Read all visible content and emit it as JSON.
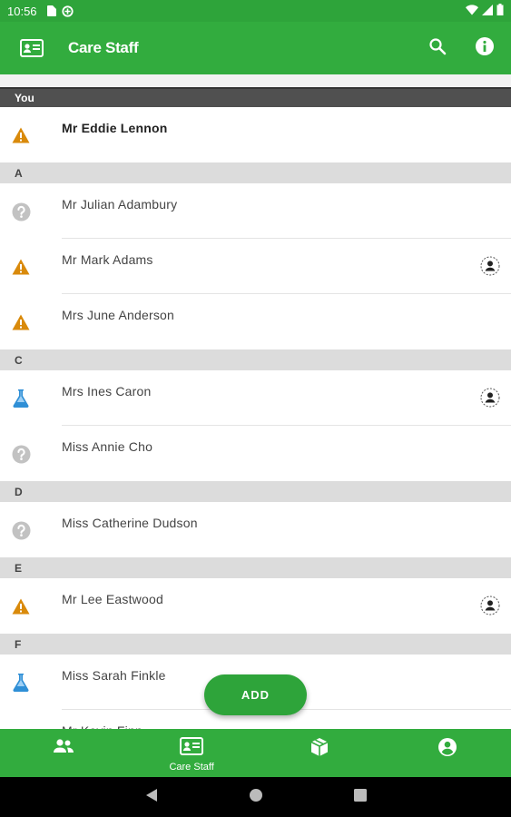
{
  "status_bar": {
    "time": "10:56",
    "left_icons": [
      "sim-card-icon",
      "data-saver-icon"
    ],
    "right_icons": [
      "wifi-icon",
      "cell-signal-icon",
      "battery-icon"
    ]
  },
  "app_bar": {
    "title": "Care Staff",
    "icons": [
      "id-card-icon",
      "search-icon",
      "info-icon"
    ]
  },
  "you_section": {
    "header": "You",
    "row": {
      "name": "Mr Eddie Lennon",
      "status_icon": "warning-icon",
      "has_person_icon": false
    }
  },
  "sections": [
    {
      "letter": "A",
      "rows": [
        {
          "name": "Mr Julian Adambury",
          "status_icon": "help-icon",
          "has_person_icon": false
        },
        {
          "name": "Mr Mark Adams",
          "status_icon": "warning-icon",
          "has_person_icon": true
        },
        {
          "name": "Mrs June Anderson",
          "status_icon": "warning-icon",
          "has_person_icon": false
        }
      ]
    },
    {
      "letter": "C",
      "rows": [
        {
          "name": "Mrs Ines Caron",
          "status_icon": "flask-icon",
          "has_person_icon": true
        },
        {
          "name": "Miss Annie Cho",
          "status_icon": "help-icon",
          "has_person_icon": false
        }
      ]
    },
    {
      "letter": "D",
      "rows": [
        {
          "name": "Miss Catherine Dudson",
          "status_icon": "help-icon",
          "has_person_icon": false
        }
      ]
    },
    {
      "letter": "E",
      "rows": [
        {
          "name": "Mr Lee Eastwood",
          "status_icon": "warning-icon",
          "has_person_icon": true
        }
      ]
    },
    {
      "letter": "F",
      "rows": [
        {
          "name": "Miss Sarah Finkle",
          "status_icon": "flask-icon",
          "has_person_icon": false
        },
        {
          "name": "Mr Kevin Finn",
          "status_icon": "help-icon",
          "has_person_icon": false
        }
      ]
    }
  ],
  "fab": {
    "label": "ADD"
  },
  "bottom_nav": {
    "tabs": [
      {
        "icon": "group-icon",
        "label": ""
      },
      {
        "icon": "id-card-icon",
        "label": "Care Staff"
      },
      {
        "icon": "package-icon",
        "label": ""
      },
      {
        "icon": "account-circle-icon",
        "label": ""
      }
    ]
  },
  "system_nav": [
    "back-icon",
    "home-icon",
    "recents-icon"
  ],
  "colors": {
    "primary": "#32ac3e",
    "warning": "#d98a0b",
    "help": "#b8b8b8",
    "flask": "#2f8fd6",
    "section_bg": "#dcdcdc",
    "you_bg": "#505050"
  }
}
